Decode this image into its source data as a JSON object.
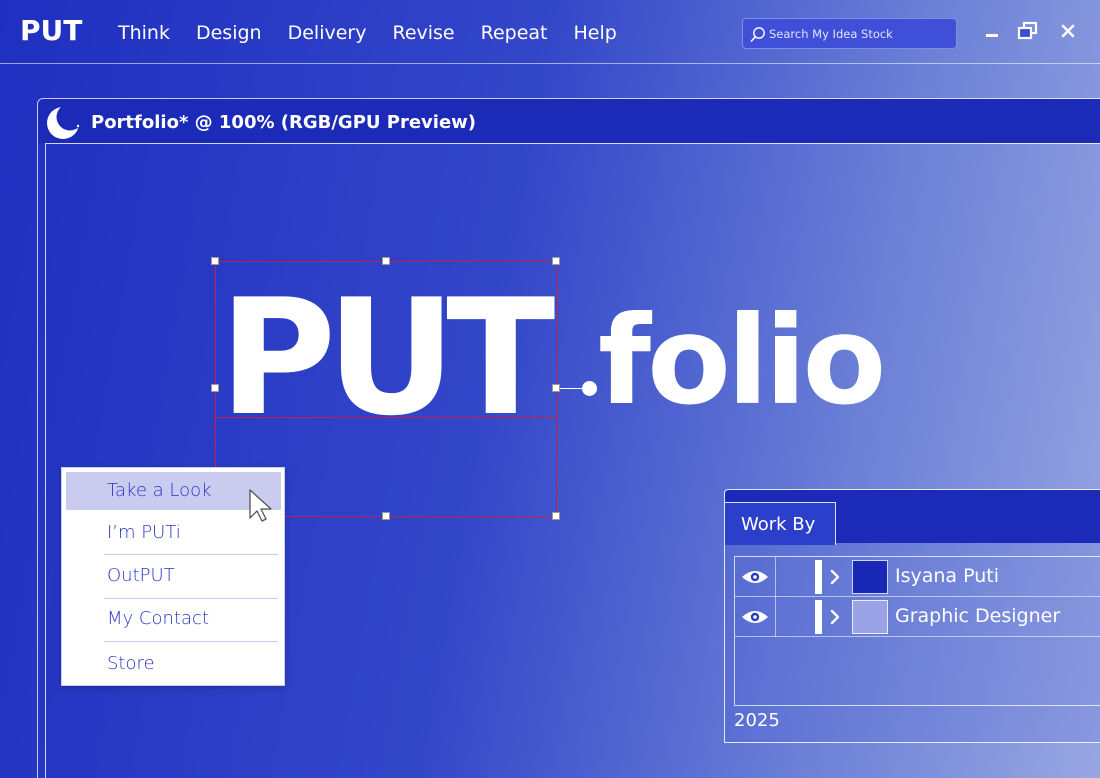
{
  "app": {
    "logo": "PUT",
    "menu": [
      "Think",
      "Design",
      "Delivery",
      "Revise",
      "Repeat",
      "Help"
    ],
    "search_placeholder": "Search My Idea Stock",
    "window_controls": [
      "minimize-icon",
      "restore-icon",
      "close-icon"
    ]
  },
  "document": {
    "title": "Portfolio* @ 100% (RGB/GPU Preview)",
    "icon": "moon-icon"
  },
  "artwork": {
    "word_main": "PUT",
    "word_suffix": "folio"
  },
  "context_menu": {
    "items": [
      {
        "label": "Take a Look",
        "active": true
      },
      {
        "label": "I’m PUTi",
        "active": false
      },
      {
        "label": "OutPUT",
        "active": false
      },
      {
        "label": "My Contact",
        "active": false
      },
      {
        "label": "Store",
        "active": false
      }
    ]
  },
  "layers_panel": {
    "tab_label": "Work By",
    "layers": [
      {
        "name": "Isyana Puti",
        "swatch": "#1a28b8",
        "visible": true
      },
      {
        "name": "Graphic Designer",
        "swatch": "#9aa3e6",
        "visible": true
      }
    ],
    "year": "2025"
  },
  "colors": {
    "accent": "#1b2bb8",
    "selection": "#c0204a",
    "menu_text": "#2a36c4",
    "menu_active_bg": "#c9cbef"
  }
}
